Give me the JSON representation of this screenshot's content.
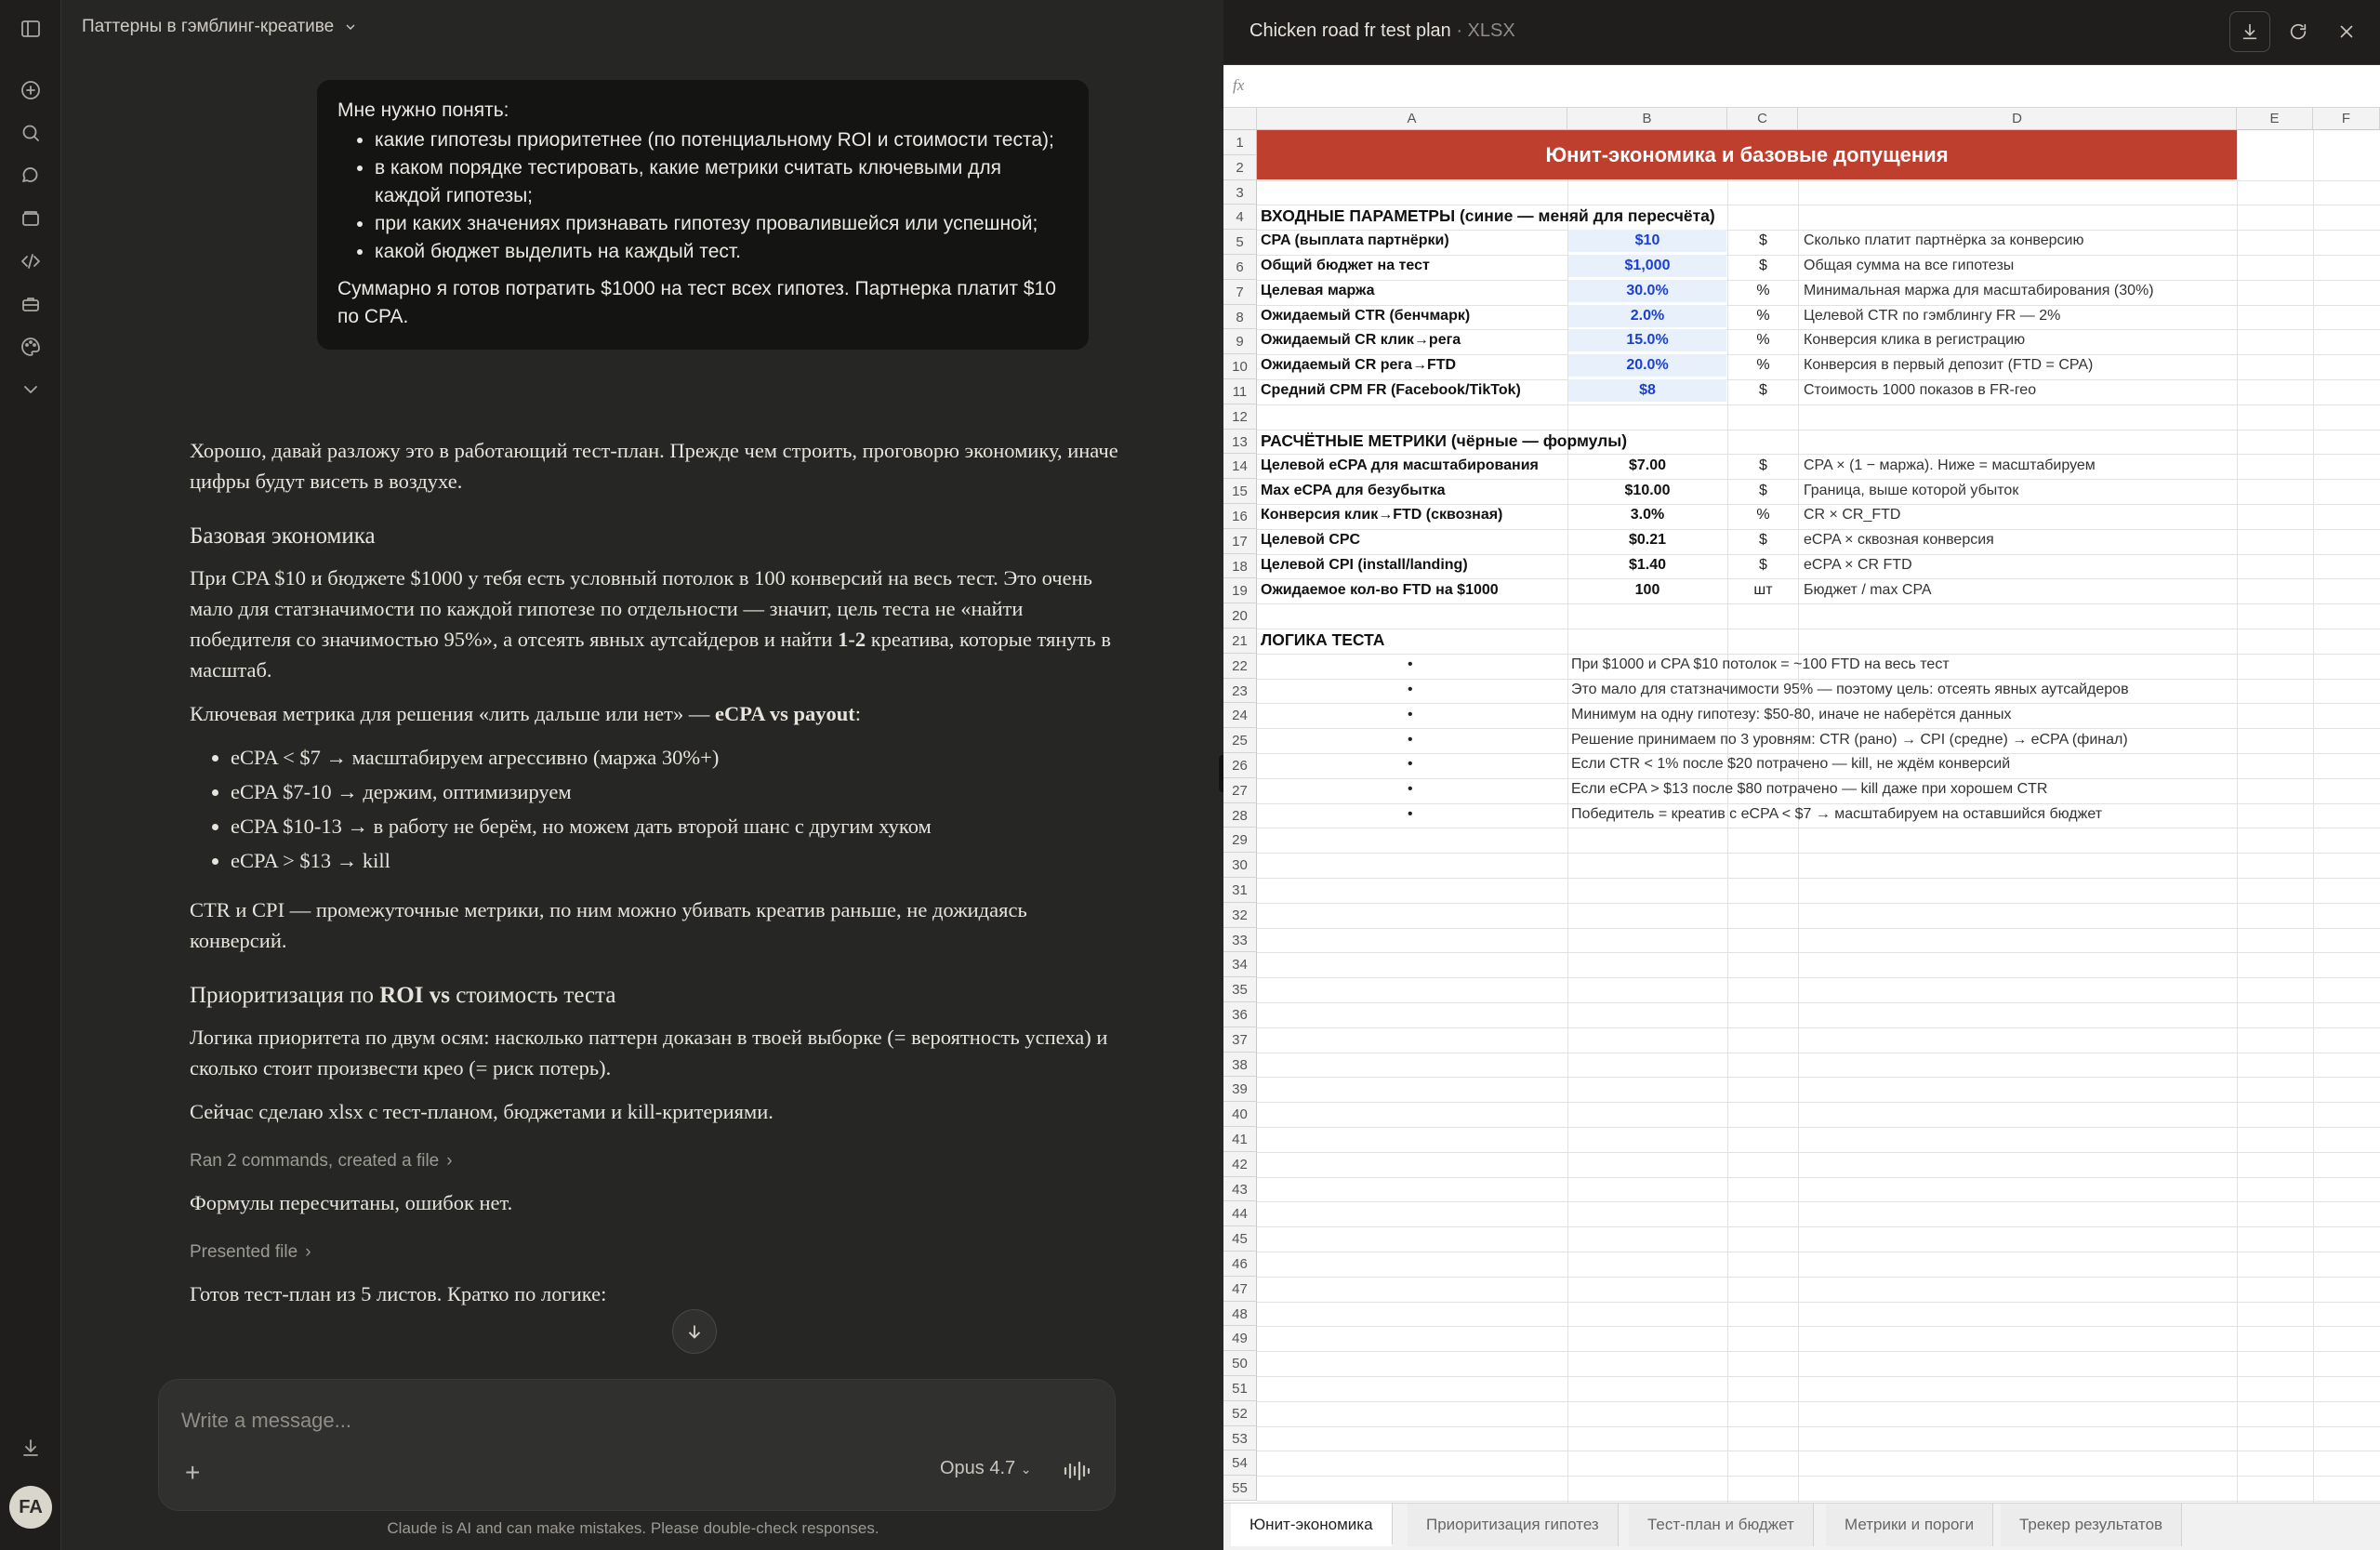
{
  "chat": {
    "title": "Паттерны в гэмблинг-креативе",
    "user_message": {
      "intro": "Мне нужно понять:",
      "items": [
        "какие гипотезы приоритетнее (по потенциальному ROI и стоимости теста);",
        "в каком порядке тестировать, какие метрики считать ключевыми для каждой гипотезы;",
        "при каких значениях признавать гипотезу провалившейся или успешной;",
        "какой бюджет выделить на каждый тест."
      ],
      "outro": "Суммарно я готов потратить $1000 на тест всех гипотез. Партнерка платит $10 по CPA."
    },
    "response": {
      "p1": "Хорошо, давай разложу это в работающий тест-план. Прежде чем строить, проговорю экономику, иначе цифры будут висеть в воздухе.",
      "h1": "Базовая экономика",
      "p2a": "При CPA $10 и бюджете $1000 у тебя есть условный потолок в 100 конверсий на весь тест. Это очень мало для статзначимости по каждой гипотезе по отдельности — значит, цель теста не «найти победителя со значимостью 95%», а отсеять явных аутсайдеров и найти ",
      "p2b": "1-2",
      "p2c": " креатива, которые тянуть в масштаб.",
      "p3a": "Ключевая метрика для решения «лить дальше или нет» — ",
      "p3b": "eCPA vs payout",
      "p3c": ":",
      "bullets": [
        "eCPA < $7 → масштабируем агрессивно (маржа 30%+)",
        "eCPA $7-10 → держим, оптимизируем",
        "eCPA $10-13 → в работу не берём, но можем дать второй шанс с другим хуком",
        "eCPA > $13 → kill"
      ],
      "p4": "CTR и CPI — промежуточные метрики, по ним можно убивать креатив раньше, не дожидаясь конверсий.",
      "h2a": "Приоритизация по ",
      "h2b": "ROI vs",
      "h2c": " стоимость теста",
      "p5": "Логика приоритета по двум осям: насколько паттерн доказан в твоей выборке (= вероятность успеха) и сколько стоит произвести крео (= риск потерь).",
      "p6": "Сейчас сделаю xlsx с тест-планом, бюджетами и kill-критериями.",
      "meta1": "Ran 2 commands, created a file",
      "p7": "Формулы пересчитаны, ошибок нет.",
      "meta2": "Presented file",
      "p8": "Готов тест-план из 5 листов. Кратко по логике:"
    },
    "composer": {
      "placeholder": "Write a message...",
      "model": "Opus 4.7"
    },
    "disclaimer": "Claude is AI and can make mistakes. Please double-check responses.",
    "avatar": "FA"
  },
  "panel": {
    "title": "Chicken road fr test plan",
    "ext": " · XLSX",
    "fx": "fx",
    "columns": [
      "A",
      "B",
      "C",
      "D",
      "E",
      "F"
    ],
    "banner": "Юнит-экономика и базовые допущения",
    "section1": "ВХОДНЫЕ ПАРАМЕТРЫ (синие — меняй для пересчёта)",
    "inputs": [
      {
        "label": "CPA (выплата партнёрки)",
        "value": "$10",
        "unit": "$",
        "note": "Сколько платит партнёрка за конверсию"
      },
      {
        "label": "Общий бюджет на тест",
        "value": "$1,000",
        "unit": "$",
        "note": "Общая сумма на все гипотезы"
      },
      {
        "label": "Целевая маржа",
        "value": "30.0%",
        "unit": "%",
        "note": "Минимальная маржа для масштабирования (30%)"
      },
      {
        "label": "Ожидаемый CTR (бенчмарк)",
        "value": "2.0%",
        "unit": "%",
        "note": "Целевой CTR по гэмблингу FR — 2%"
      },
      {
        "label": "Ожидаемый CR клик→рега",
        "value": "15.0%",
        "unit": "%",
        "note": "Конверсия клика в регистрацию"
      },
      {
        "label": "Ожидаемый CR рега→FTD",
        "value": "20.0%",
        "unit": "%",
        "note": "Конверсия в первый депозит (FTD = CPA)"
      },
      {
        "label": "Средний CPM FR (Facebook/TikTok)",
        "value": "$8",
        "unit": "$",
        "note": "Стоимость 1000 показов в FR-гео"
      }
    ],
    "section2": "РАСЧЁТНЫЕ МЕТРИКИ (чёрные — формулы)",
    "calcs": [
      {
        "label": "Целевой eCPA для масштабирования",
        "value": "$7.00",
        "unit": "$",
        "note": "CPA × (1 − маржа). Ниже = масштабируем"
      },
      {
        "label": "Max eCPA для безубытка",
        "value": "$10.00",
        "unit": "$",
        "note": "Граница, выше которой убыток"
      },
      {
        "label": "Конверсия клик→FTD (сквозная)",
        "value": "3.0%",
        "unit": "%",
        "note": "CR × CR_FTD"
      },
      {
        "label": "Целевой CPC",
        "value": "$0.21",
        "unit": "$",
        "note": "eCPA × сквозная конверсия"
      },
      {
        "label": "Целевой CPI (install/landing)",
        "value": "$1.40",
        "unit": "$",
        "note": "eCPA × CR FTD"
      },
      {
        "label": "Ожидаемое кол-во FTD на $1000",
        "value": "100",
        "unit": "шт",
        "note": "Бюджет / max CPA"
      }
    ],
    "section3": "ЛОГИКА ТЕСТА",
    "bullet_char": "•",
    "logic": [
      "При $1000 и CPA $10 потолок = ~100 FTD на весь тест",
      "Это мало для статзначимости 95% — поэтому цель: отсеять явных аутсайдеров",
      "Минимум на одну гипотезу: $50-80, иначе не наберётся данных",
      "Решение принимаем по 3 уровням: CTR (рано) → CPI (средне) → eCPA (финал)",
      "Если CTR < 1% после $20 потрачено — kill, не ждём конверсий",
      "Если eCPA > $13 после $80 потрачено — kill даже при хорошем CTR",
      "Победитель = креатив с eCPA < $7 → масштабируем на оставшийся бюджет"
    ],
    "tabs": [
      "Юнит-экономика",
      "Приоритизация гипотез",
      "Тест-план и бюджет",
      "Метрики и пороги",
      "Трекер результатов"
    ]
  }
}
